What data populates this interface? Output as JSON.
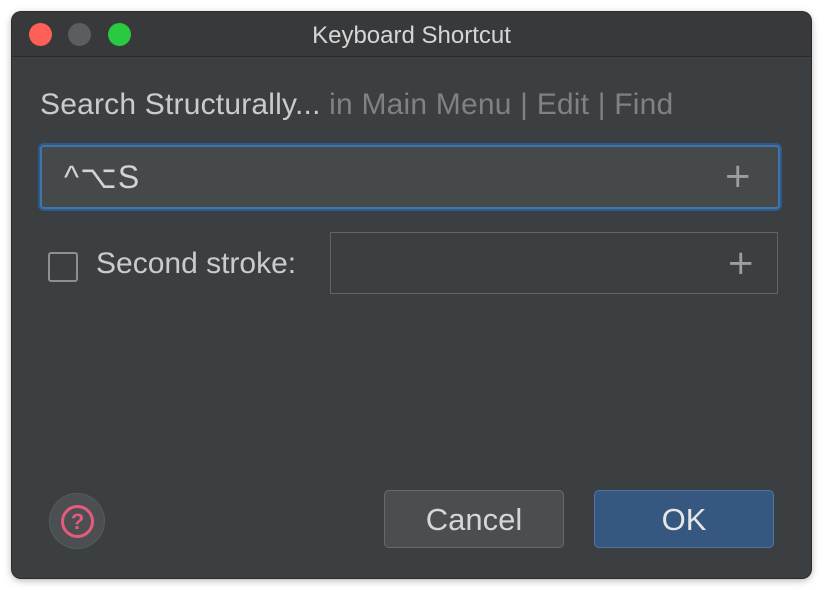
{
  "window": {
    "title": "Keyboard Shortcut"
  },
  "heading": {
    "action": "Search Structurally...",
    "path": " in Main Menu | Edit | Find"
  },
  "shortcut": {
    "value": "^⌥S",
    "add_icon": "plus-icon"
  },
  "second_stroke": {
    "checked": false,
    "label": "Second stroke:",
    "value": "",
    "add_icon": "plus-icon"
  },
  "buttons": {
    "help_icon": "question-circle-icon",
    "cancel_label": "Cancel",
    "ok_label": "OK"
  },
  "colors": {
    "background": "#3c3f41",
    "accent": "#365880",
    "focus_border": "#3f74ad",
    "help": "#e55a7d"
  }
}
